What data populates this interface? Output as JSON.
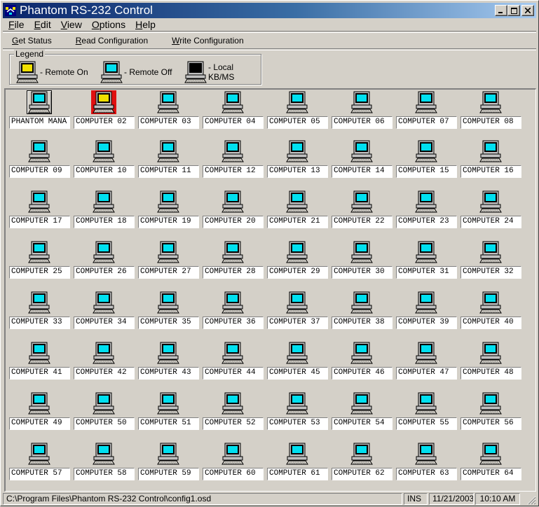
{
  "window": {
    "title": "Phantom RS-232 Control"
  },
  "menu": {
    "items": [
      "File",
      "Edit",
      "View",
      "Options",
      "Help"
    ]
  },
  "toolbar": {
    "get_status": "Get Status",
    "read_config": "Read Configuration",
    "write_config": "Write Configuration"
  },
  "legend": {
    "title": "Legend",
    "remote_on": "- Remote On",
    "remote_off": "- Remote Off",
    "local": "- Local KB/MS"
  },
  "colors": {
    "remote_on_screen": "#f0e000",
    "remote_off_screen": "#00e0f0",
    "local_screen": "#000000",
    "remote_on_highlight": "#e01010",
    "titlebar_start": "#0a246a"
  },
  "computers": [
    {
      "name": "PHANTOM MANA",
      "state": "off",
      "selected": true
    },
    {
      "name": "COMPUTER 02",
      "state": "on"
    },
    {
      "name": "COMPUTER 03",
      "state": "off"
    },
    {
      "name": "COMPUTER 04",
      "state": "off"
    },
    {
      "name": "COMPUTER 05",
      "state": "off"
    },
    {
      "name": "COMPUTER 06",
      "state": "off"
    },
    {
      "name": "COMPUTER 07",
      "state": "off"
    },
    {
      "name": "COMPUTER 08",
      "state": "off"
    },
    {
      "name": "COMPUTER 09",
      "state": "off"
    },
    {
      "name": "COMPUTER 10",
      "state": "off"
    },
    {
      "name": "COMPUTER 11",
      "state": "off"
    },
    {
      "name": "COMPUTER 12",
      "state": "off"
    },
    {
      "name": "COMPUTER 13",
      "state": "off"
    },
    {
      "name": "COMPUTER 14",
      "state": "off"
    },
    {
      "name": "COMPUTER 15",
      "state": "off"
    },
    {
      "name": "COMPUTER 16",
      "state": "off"
    },
    {
      "name": "COMPUTER 17",
      "state": "off"
    },
    {
      "name": "COMPUTER 18",
      "state": "off"
    },
    {
      "name": "COMPUTER 19",
      "state": "off"
    },
    {
      "name": "COMPUTER 20",
      "state": "off"
    },
    {
      "name": "COMPUTER 21",
      "state": "off"
    },
    {
      "name": "COMPUTER 22",
      "state": "off"
    },
    {
      "name": "COMPUTER 23",
      "state": "off"
    },
    {
      "name": "COMPUTER 24",
      "state": "off"
    },
    {
      "name": "COMPUTER 25",
      "state": "off"
    },
    {
      "name": "COMPUTER 26",
      "state": "off"
    },
    {
      "name": "COMPUTER 27",
      "state": "off"
    },
    {
      "name": "COMPUTER 28",
      "state": "off"
    },
    {
      "name": "COMPUTER 29",
      "state": "off"
    },
    {
      "name": "COMPUTER 30",
      "state": "off"
    },
    {
      "name": "COMPUTER 31",
      "state": "off"
    },
    {
      "name": "COMPUTER 32",
      "state": "off"
    },
    {
      "name": "COMPUTER 33",
      "state": "off"
    },
    {
      "name": "COMPUTER 34",
      "state": "off"
    },
    {
      "name": "COMPUTER 35",
      "state": "off"
    },
    {
      "name": "COMPUTER 36",
      "state": "off"
    },
    {
      "name": "COMPUTER 37",
      "state": "off"
    },
    {
      "name": "COMPUTER 38",
      "state": "off"
    },
    {
      "name": "COMPUTER 39",
      "state": "off"
    },
    {
      "name": "COMPUTER 40",
      "state": "off"
    },
    {
      "name": "COMPUTER 41",
      "state": "off"
    },
    {
      "name": "COMPUTER 42",
      "state": "off"
    },
    {
      "name": "COMPUTER 43",
      "state": "off"
    },
    {
      "name": "COMPUTER 44",
      "state": "off"
    },
    {
      "name": "COMPUTER 45",
      "state": "off"
    },
    {
      "name": "COMPUTER 46",
      "state": "off"
    },
    {
      "name": "COMPUTER 47",
      "state": "off"
    },
    {
      "name": "COMPUTER 48",
      "state": "off"
    },
    {
      "name": "COMPUTER 49",
      "state": "off"
    },
    {
      "name": "COMPUTER 50",
      "state": "off"
    },
    {
      "name": "COMPUTER 51",
      "state": "off"
    },
    {
      "name": "COMPUTER 52",
      "state": "off"
    },
    {
      "name": "COMPUTER 53",
      "state": "off"
    },
    {
      "name": "COMPUTER 54",
      "state": "off"
    },
    {
      "name": "COMPUTER 55",
      "state": "off"
    },
    {
      "name": "COMPUTER 56",
      "state": "off"
    },
    {
      "name": "COMPUTER 57",
      "state": "off"
    },
    {
      "name": "COMPUTER 58",
      "state": "off"
    },
    {
      "name": "COMPUTER 59",
      "state": "off"
    },
    {
      "name": "COMPUTER 60",
      "state": "off"
    },
    {
      "name": "COMPUTER 61",
      "state": "off"
    },
    {
      "name": "COMPUTER 62",
      "state": "off"
    },
    {
      "name": "COMPUTER 63",
      "state": "off"
    },
    {
      "name": "COMPUTER 64",
      "state": "off"
    }
  ],
  "status": {
    "path": "C:\\Program Files\\Phantom RS-232 Control\\config1.osd",
    "mode": "INS",
    "date": "11/21/2003",
    "time": "10:10 AM"
  }
}
